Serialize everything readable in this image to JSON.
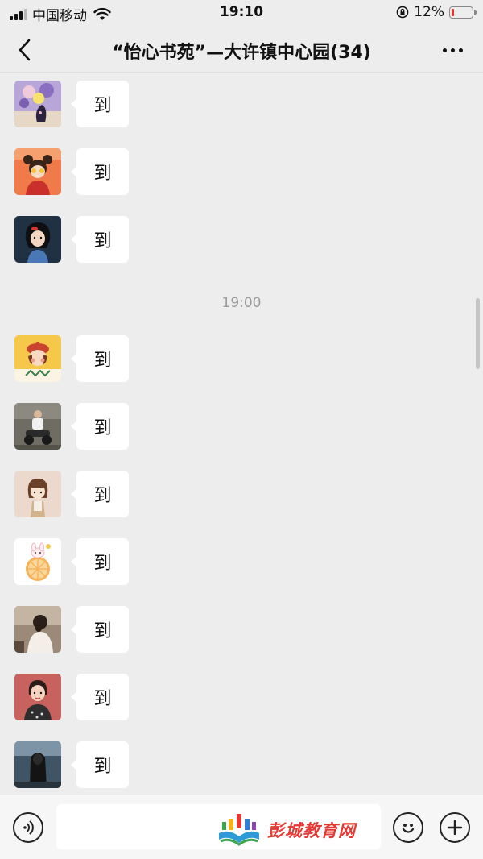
{
  "status_bar": {
    "carrier": "中国移动",
    "time": "19:10",
    "battery_percent": "12%",
    "battery_level": 0.12,
    "battery_color": "#e0362c"
  },
  "nav": {
    "back_icon": "chevron-left-icon",
    "title": "“怡心书苑”—大许镇中心园(34)",
    "more_icon": "more-dots-icon"
  },
  "chat": {
    "timestamp": "19:00",
    "messages": [
      {
        "text": "到",
        "avatar": "avatar-flowers-vase"
      },
      {
        "text": "到",
        "avatar": "avatar-cartoon-girl-buns"
      },
      {
        "text": "到",
        "avatar": "avatar-cartoon-girl-black-hair"
      },
      {
        "text": "到",
        "avatar": "avatar-cartoon-girl-red-beret"
      },
      {
        "text": "到",
        "avatar": "avatar-child-on-scooter-photo"
      },
      {
        "text": "到",
        "avatar": "avatar-cartoon-girl-bob"
      },
      {
        "text": "到",
        "avatar": "avatar-bunny-orange-slice"
      },
      {
        "text": "到",
        "avatar": "avatar-woman-back-photo"
      },
      {
        "text": "到",
        "avatar": "avatar-cartoon-girl-pink"
      },
      {
        "text": "到",
        "avatar": "avatar-girl-long-hair-photo"
      }
    ]
  },
  "input_bar": {
    "voice_icon": "voice-icon",
    "emoji_icon": "emoji-icon",
    "plus_icon": "plus-icon",
    "watermark_text": "彭城教育网"
  },
  "colors": {
    "background": "#ededed",
    "bubble": "#ffffff",
    "timestamp": "#9a9a9a",
    "watermark": "#e53935"
  }
}
